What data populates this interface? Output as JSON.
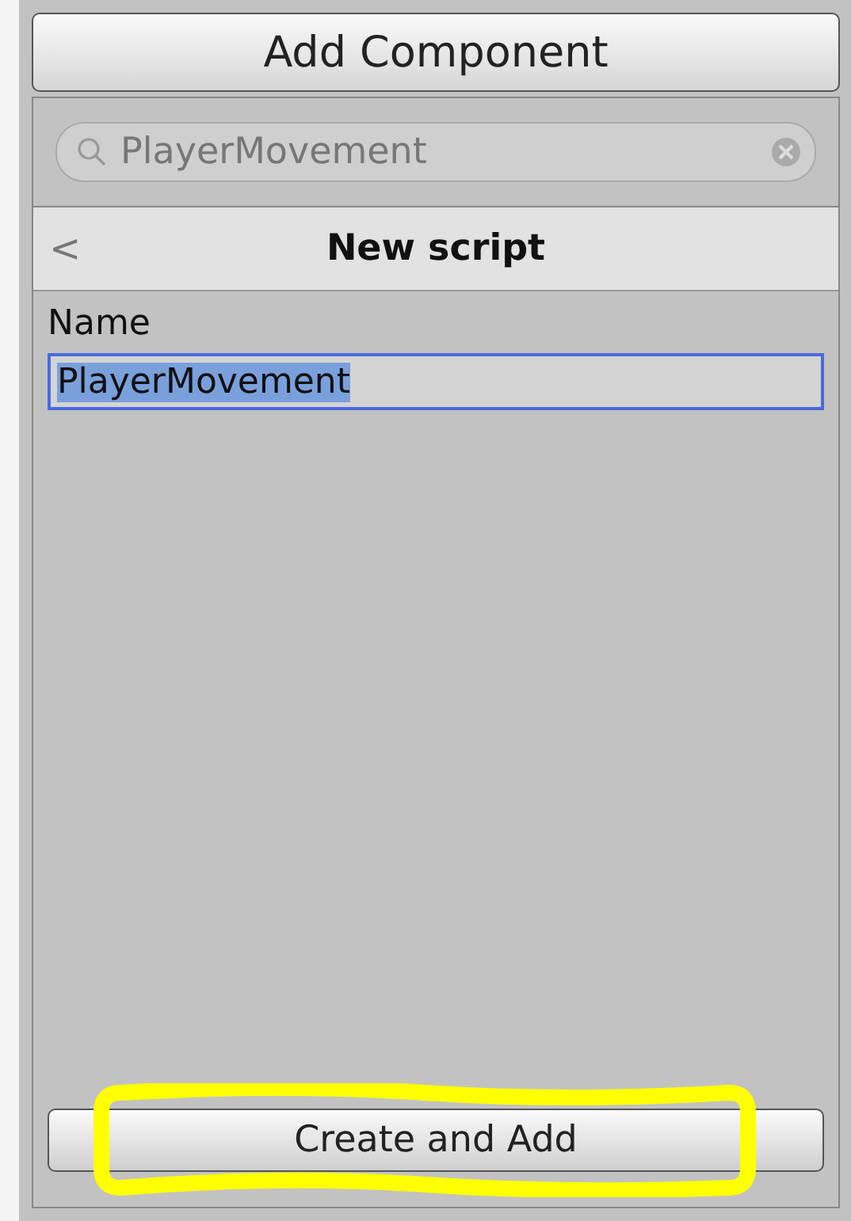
{
  "header_button": {
    "label": "Add Component"
  },
  "search": {
    "value": "PlayerMovement"
  },
  "panel": {
    "title": "New script",
    "back": "<"
  },
  "name_field": {
    "label": "Name",
    "value": "PlayerMovement",
    "selected": true
  },
  "action_button": {
    "label": "Create and Add",
    "highlighted": true
  }
}
